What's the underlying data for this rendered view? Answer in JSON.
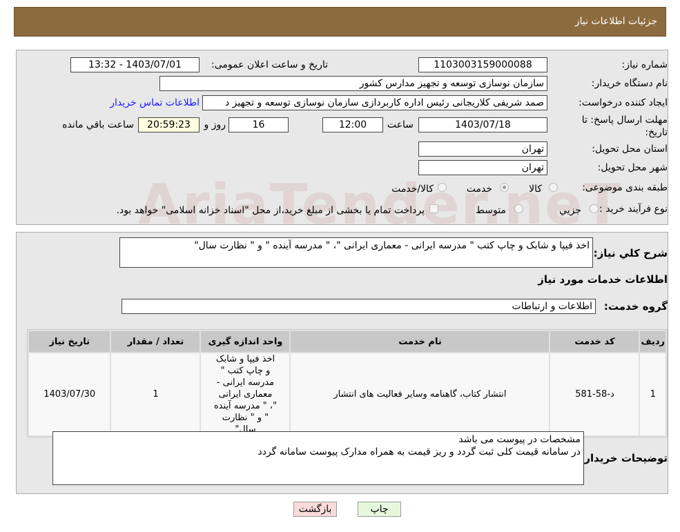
{
  "header": {
    "title": "جزئیات اطلاعات نیاز"
  },
  "form": {
    "need_number_label": "شماره نیاز:",
    "need_number": "1103003159000088",
    "announce_label": "تاریخ و ساعت اعلان عمومی:",
    "announce_value": "1403/07/01 - 13:32",
    "buyer_label": "نام دستگاه خریدار:",
    "buyer": "سازمان نوسازی  توسعه و تجهیز مدارس کشور",
    "creator_label": "ایجاد کننده درخواست:",
    "creator": "صمد شریفی کلاریجانی رئیس اداره کاربردازی سازمان نوسازی  توسعه و تجهیز د",
    "contact_link": "اطلاعات تماس خریدار",
    "deadline_label": "مهلت ارسال پاسخ: تا تاریخ:",
    "deadline_date": "1403/07/18",
    "time_label": "ساعت",
    "deadline_time": "12:00",
    "days": "16",
    "days_label": "روز و",
    "remaining": "20:59:23",
    "remaining_label": "ساعت باقي مانده",
    "province_label": "استان محل تحویل:",
    "province": "تهران",
    "city_label": "شهر محل تحویل:",
    "city": "تهران",
    "category_label": "طبقه بندی موضوعی:",
    "category_options": [
      "کالا",
      "خدمت",
      "کالا/خدمت"
    ],
    "category_selected": "خدمت",
    "process_label": "نوع فرآیند خرید :",
    "process_options": [
      "جزیي",
      "متوسط"
    ],
    "process_note": "پرداخت تمام یا بخشی از مبلغ خرید،از محل \"اسناد خزانه اسلامی\" خواهد بود."
  },
  "details": {
    "summary_label": "شرح کلي نیاز:",
    "summary": "اخذ فیپا و شابک و چاپ کتب \" مدرسه ایرانی - معماری ایرانی \"، \" مدرسه آینده \" و \" نظارت سال\"",
    "services_title": "اطلاعات خدمات مورد نیاز",
    "group_label": "گروه خدمت:",
    "group": "اطلاعات و ارتباطات",
    "table": {
      "headers": [
        "ردیف",
        "کد خدمت",
        "نام خدمت",
        "واحد اندازه گیری",
        "تعداد / مقدار",
        "تاریخ نیاز"
      ],
      "rows": [
        [
          "1",
          "د-58-581",
          "انتشار کتاب، گاهنامه وسایر فعالیت های انتشار",
          "اخذ فیپا و شابک و چاپ کتب \" مدرسه ایرانی - معماری ایرانی \"، \" مدرسه آینده \" و \" نظارت سال\"",
          "1",
          "1403/07/30"
        ]
      ]
    },
    "notes_label": "توضیحات خریدار:",
    "notes_line1": "مشخصات در پیوست می باشد",
    "notes_line2": "در سامانه قیمت کلی ثبت گردد و ریز قیمت به همراه مدارک پیوست سامانه گردد"
  },
  "buttons": {
    "print": "چاپ",
    "back": "بازگشت"
  },
  "watermark": "AriaTender.neT"
}
